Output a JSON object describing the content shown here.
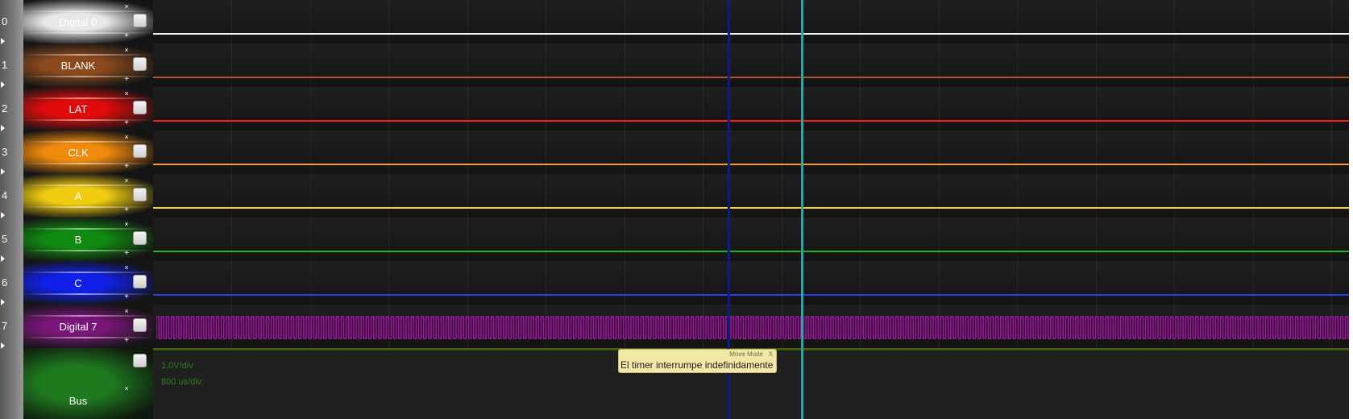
{
  "channels": [
    {
      "index": "0",
      "name": "Digital 0",
      "color": "#e8e8e8",
      "trace": "#f2f2f2"
    },
    {
      "index": "1",
      "name": "BLANK",
      "color": "#8b4a1e",
      "trace": "#b4561f"
    },
    {
      "index": "2",
      "name": "LAT",
      "color": "#e00b0b",
      "trace": "#ff1a1a"
    },
    {
      "index": "3",
      "name": "CLK",
      "color": "#f08a0c",
      "trace": "#ff9a1e"
    },
    {
      "index": "4",
      "name": "A",
      "color": "#f0cc10",
      "trace": "#ffd21c"
    },
    {
      "index": "5",
      "name": "B",
      "color": "#108a10",
      "trace": "#20b020"
    },
    {
      "index": "6",
      "name": "C",
      "color": "#1020e8",
      "trace": "#2a3cff"
    },
    {
      "index": "7",
      "name": "Digital 7",
      "color": "#7a167a",
      "trace": "#9a1c9a"
    }
  ],
  "bus": {
    "name": "Bus",
    "color": "#1f7a1f"
  },
  "scale": {
    "volts_per_div": "1,0V/div",
    "time_per_div": "800 us/div"
  },
  "annotation": {
    "mode_label": "Move Mode",
    "close_label": "X",
    "text": "El timer interrumpe indefinidamente"
  },
  "cursors": [
    {
      "name": "cursor-a",
      "color": "#0c1a8a",
      "position_fraction": 0.479
    },
    {
      "name": "cursor-b",
      "color": "#2aa6a6",
      "position_fraction": 0.54
    }
  ],
  "icons": {
    "close": "×",
    "add": "+",
    "expand": "arrow-right-icon"
  }
}
